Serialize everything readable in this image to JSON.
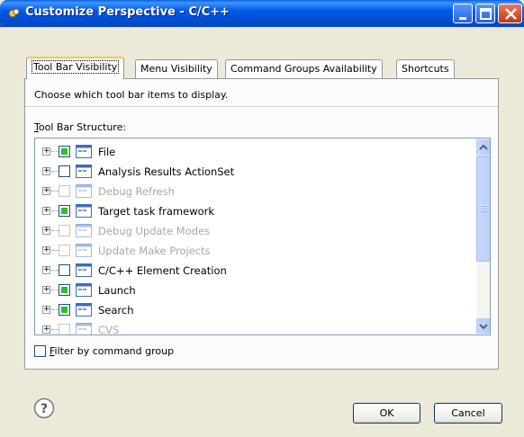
{
  "window": {
    "title": "Customize Perspective - C/C++"
  },
  "tabs": [
    {
      "label": "Tool Bar Visibility",
      "active": true
    },
    {
      "label": "Menu Visibility",
      "active": false
    },
    {
      "label": "Command Groups Availability",
      "active": false
    },
    {
      "label": "Shortcuts",
      "active": false
    }
  ],
  "panel": {
    "hint": "Choose which tool bar items to display.",
    "structure_label_mnemonic": "T",
    "structure_label_rest": "ool Bar Structure:"
  },
  "tree_items": [
    {
      "label": "File",
      "checked": true,
      "enabled": true
    },
    {
      "label": "Analysis Results ActionSet",
      "checked": false,
      "enabled": true
    },
    {
      "label": "Debug Refresh",
      "checked": false,
      "enabled": false
    },
    {
      "label": "Target task framework",
      "checked": true,
      "enabled": true
    },
    {
      "label": "Debug Update Modes",
      "checked": false,
      "enabled": false
    },
    {
      "label": "Update Make Projects",
      "checked": false,
      "enabled": false
    },
    {
      "label": "C/C++ Element Creation",
      "checked": false,
      "enabled": true
    },
    {
      "label": "Launch",
      "checked": true,
      "enabled": true
    },
    {
      "label": "Search",
      "checked": true,
      "enabled": true
    },
    {
      "label": "CVS",
      "checked": false,
      "enabled": false
    }
  ],
  "filter": {
    "mnemonic": "F",
    "label_rest": "ilter by command group",
    "checked": false
  },
  "buttons": {
    "ok": "OK",
    "cancel": "Cancel"
  },
  "icons": {
    "title": "eclipse-perspective-icon",
    "help": "help-icon",
    "toolbar_item": "toolbar-icon"
  }
}
